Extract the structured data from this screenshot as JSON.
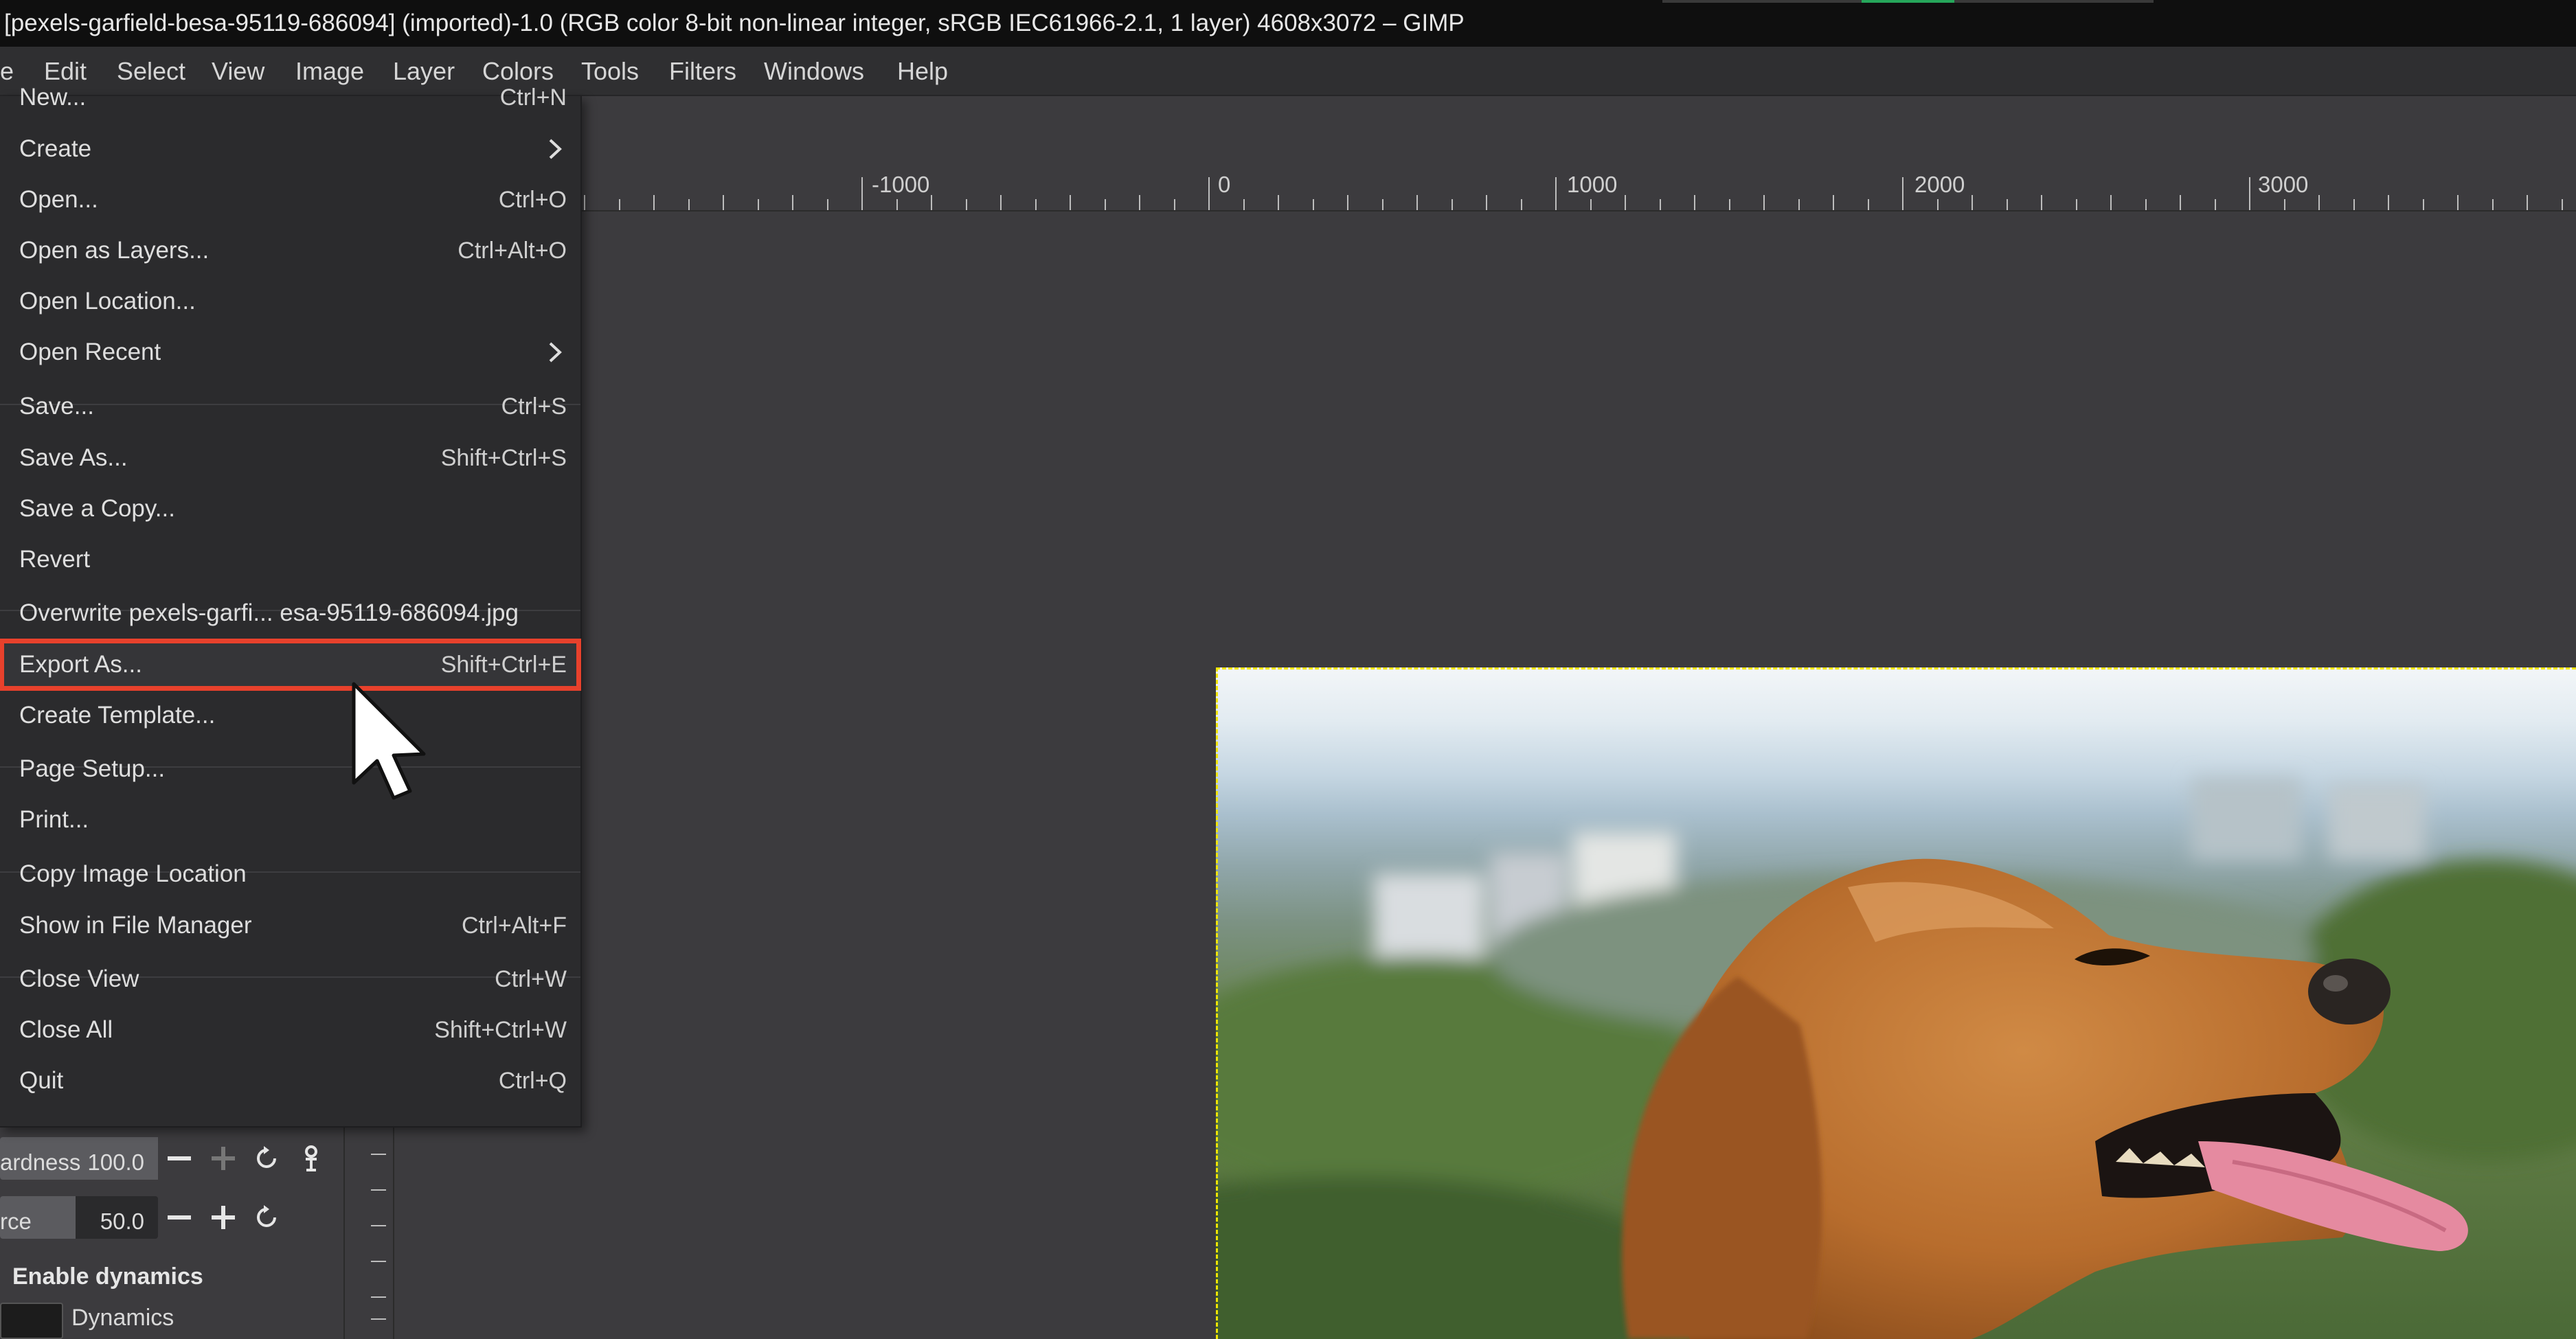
{
  "window": {
    "title": "[pexels-garfield-besa-95119-686094] (imported)-1.0 (RGB color 8-bit non-linear integer, sRGB IEC61966-2.1, 1 layer) 4608x3072 – GIMP"
  },
  "menubar": {
    "items": [
      {
        "label": "e"
      },
      {
        "label": "Edit"
      },
      {
        "label": "Select"
      },
      {
        "label": "View"
      },
      {
        "label": "Image"
      },
      {
        "label": "Layer"
      },
      {
        "label": "Colors"
      },
      {
        "label": "Tools"
      },
      {
        "label": "Filters"
      },
      {
        "label": "Windows"
      },
      {
        "label": "Help"
      }
    ]
  },
  "ruler": {
    "labels": [
      "-1000",
      "0",
      "1000",
      "2000",
      "3000"
    ]
  },
  "file_menu": {
    "items": [
      {
        "label": "New...",
        "shortcut": "Ctrl+N"
      },
      {
        "label": "Create",
        "shortcut": ""
      },
      {
        "label": "Open...",
        "shortcut": "Ctrl+O"
      },
      {
        "label": "Open as Layers...",
        "shortcut": "Ctrl+Alt+O"
      },
      {
        "label": "Open Location...",
        "shortcut": ""
      },
      {
        "label": "Open Recent",
        "shortcut": ""
      },
      {
        "label": "Save...",
        "shortcut": "Ctrl+S"
      },
      {
        "label": "Save As...",
        "shortcut": "Shift+Ctrl+S"
      },
      {
        "label": "Save a Copy...",
        "shortcut": ""
      },
      {
        "label": "Revert",
        "shortcut": ""
      },
      {
        "label": "Overwrite pexels-garfi... esa-95119-686094.jpg",
        "shortcut": ""
      },
      {
        "label": "Export As...",
        "shortcut": "Shift+Ctrl+E"
      },
      {
        "label": "Create Template...",
        "shortcut": ""
      },
      {
        "label": "Page Setup...",
        "shortcut": ""
      },
      {
        "label": "Print...",
        "shortcut": ""
      },
      {
        "label": "Copy Image Location",
        "shortcut": ""
      },
      {
        "label": "Show in File Manager",
        "shortcut": "Ctrl+Alt+F"
      },
      {
        "label": "Close View",
        "shortcut": "Ctrl+W"
      },
      {
        "label": "Close All",
        "shortcut": "Shift+Ctrl+W"
      },
      {
        "label": "Quit",
        "shortcut": "Ctrl+Q"
      }
    ],
    "highlighted": "Export As...",
    "highlight_color": "#e8412c"
  },
  "tool_options": {
    "hardness_label": "ardness",
    "hardness_value": "100.0",
    "force_label": "rce",
    "force_value": "50.0",
    "enable_dynamics_label": "Enable dynamics",
    "dynamics_label": "Dynamics"
  },
  "colors": {
    "menu_bg": "#2b2b2d",
    "canvas_bg": "#3c3b3e",
    "title_bg": "#0f0f0f"
  }
}
